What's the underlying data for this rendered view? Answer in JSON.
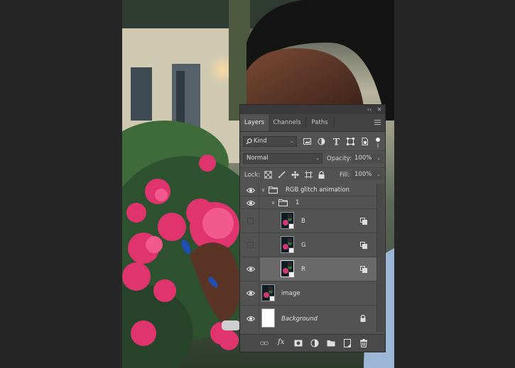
{
  "panel": {
    "tabs": [
      {
        "label": "Layers",
        "active": true
      },
      {
        "label": "Channels",
        "active": false
      },
      {
        "label": "Paths",
        "active": false
      }
    ],
    "collapse_icon": "double-chevron-icon",
    "close_icon": "close-icon",
    "filter": {
      "label": "Kind"
    },
    "filter_icons": [
      "image-filter-icon",
      "adjustment-filter-icon",
      "type-filter-icon",
      "shape-filter-icon",
      "smart-object-filter-icon"
    ],
    "blend_mode": "Normal",
    "opacity_label": "Opacity:",
    "opacity_value": "100%",
    "lock_label": "Lock:",
    "fill_label": "Fill:",
    "fill_value": "100%",
    "layers": [
      {
        "name": "RGB glitch animation",
        "type": "group",
        "visible": true,
        "expanded": true,
        "indent": 0
      },
      {
        "name": "1",
        "type": "group",
        "visible": true,
        "expanded": true,
        "indent": 1
      },
      {
        "name": "B",
        "type": "smart-object",
        "visible": false,
        "indent": 2,
        "fx_icon": "layer-style-icon"
      },
      {
        "name": "G",
        "type": "smart-object",
        "visible": false,
        "indent": 2,
        "fx_icon": "layer-style-icon"
      },
      {
        "name": "R",
        "type": "smart-object",
        "visible": true,
        "indent": 2,
        "selected": true,
        "fx_icon": "layer-style-icon"
      },
      {
        "name": "image",
        "type": "smart-object",
        "visible": true,
        "indent": 0
      },
      {
        "name": "Background",
        "type": "background",
        "visible": true,
        "locked": true,
        "indent": 0
      }
    ],
    "bottom_icons": [
      "link-icon",
      "fx-icon",
      "mask-icon",
      "adjustment-icon",
      "folder-icon",
      "new-layer-icon",
      "trash-icon"
    ],
    "bottom_fx_label": "fx"
  },
  "colors": {
    "panel_bg": "#535353",
    "selected_row": "#6a6a6a",
    "app_bg": "#262626"
  }
}
